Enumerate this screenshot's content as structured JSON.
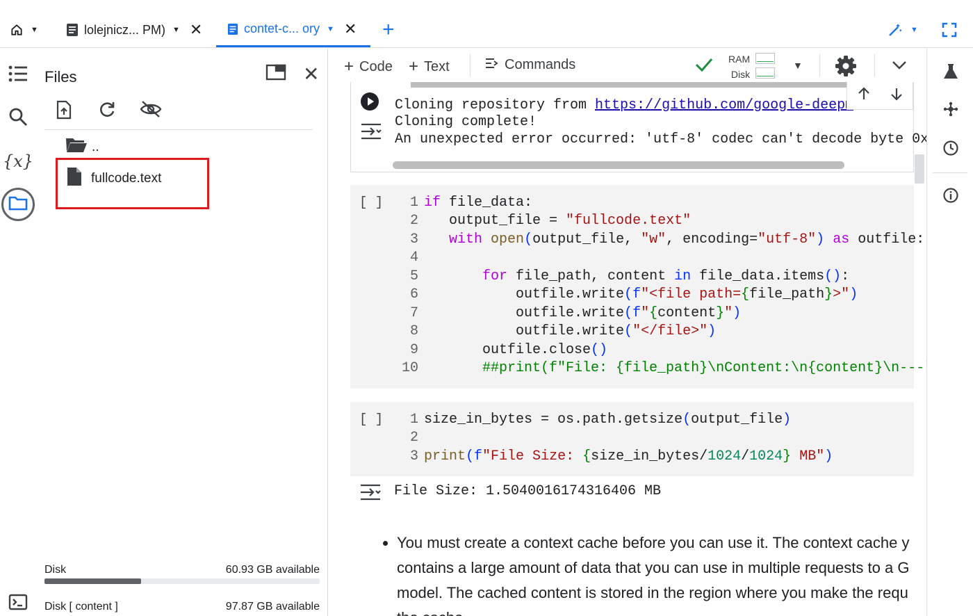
{
  "tabs": [
    {
      "label": "lolejnicz...  PM)",
      "active": false
    },
    {
      "label": "contet-c...  ory",
      "active": true
    }
  ],
  "files_panel": {
    "title": "Files",
    "parent_dir": "..",
    "file_name": "fullcode.text",
    "disk_label": "Disk",
    "disk_available": "60.93 GB available",
    "disk_used_fraction": 0.35,
    "disk2_label": "Disk [ content ]",
    "disk2_available": "97.87 GB available"
  },
  "toolbar": {
    "code_label": "Code",
    "text_label": "Text",
    "commands_label": "Commands",
    "ram_label": "RAM",
    "disk_label": "Disk"
  },
  "output1": {
    "line1_prefix": "Cloning repository from ",
    "line1_link": "https://github.com/google-deepm",
    "line2": "Cloning complete!",
    "line3": "An unexpected error occurred: 'utf-8' codec can't decode byte 0x"
  },
  "cell1": {
    "bracket": "[ ]",
    "line_numbers": [
      "1",
      "2",
      "3",
      "4",
      "5",
      "6",
      "7",
      "8",
      "9",
      "10"
    ]
  },
  "cell2": {
    "bracket": "[ ]",
    "line_numbers": [
      "1",
      "2",
      "3"
    ]
  },
  "output2": {
    "text": "File Size: 1.5040016174316406 MB"
  },
  "text_cell": {
    "line1": "You must create a context cache before you can use it. The context cache y",
    "line2": "contains a large amount of data that you can use in multiple requests to a G",
    "line3": "model. The cached content is stored in the region where you make the requ",
    "line4": "the cache."
  },
  "colors": {
    "accent": "#1a73e8",
    "highlight": "#e0191e",
    "ok_green": "#1e8e3e"
  }
}
